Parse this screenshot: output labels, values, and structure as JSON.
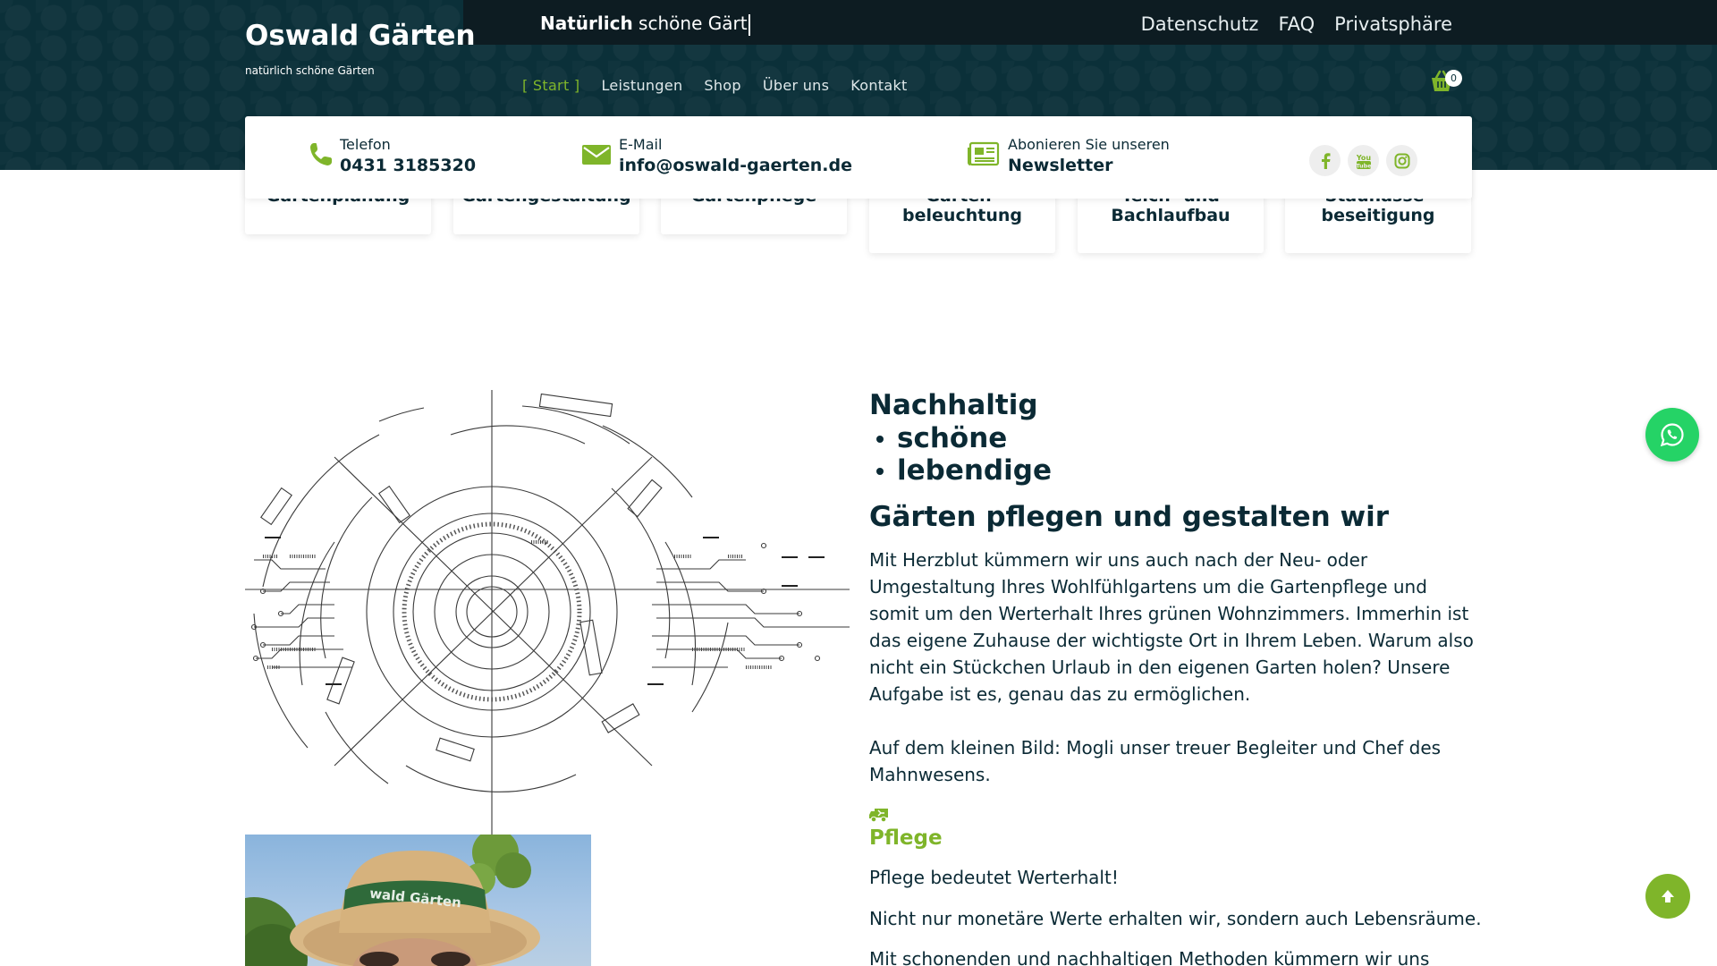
{
  "brand": {
    "title": "Oswald Gärten",
    "subtitle": "natürlich schöne Gärten"
  },
  "topbar": {
    "typing_bold": "Natürlich",
    "typing_rest": " schöne Gärt",
    "links": [
      "Datenschutz",
      "FAQ",
      "Privatsphäre"
    ]
  },
  "nav": {
    "items": [
      "[ Start ]",
      "Leistungen",
      "Shop",
      "Über uns",
      "Kontakt"
    ],
    "active_index": 0,
    "cart_count": "0",
    "cart_icon": "basket-icon"
  },
  "contact": {
    "phone": {
      "label": "Telefon",
      "value": "0431 3185320",
      "icon": "phone-icon"
    },
    "email": {
      "label": "E-Mail",
      "value": "info@oswald-gaerten.de",
      "icon": "envelope-icon"
    },
    "newsletter": {
      "label": "Abonieren Sie unseren",
      "value": "Newsletter",
      "icon": "newspaper-icon"
    },
    "social": [
      "facebook-icon",
      "youtube-icon",
      "instagram-icon"
    ]
  },
  "services": [
    "Gartenplanung",
    "Gartengestaltung",
    "Gartenpflege",
    "Garten-\nbeleuchtung",
    "Teich- und\nBachlaufbau",
    "Staunässe-\nbeseitigung"
  ],
  "content": {
    "heading_first": "Nachhaltig",
    "heading_list": [
      "schöne",
      "lebendige"
    ],
    "heading_2": "Gärten pflegen und gestalten wir",
    "paragraph_1": "Mit Herzblut kümmern wir uns auch nach der Neu- oder Umgestaltung Ihres Wohlfühlgartens um die Gartenpflege und somit um den Werterhalt Ihres grünen Wohnzimmers. Immerhin ist das eigene Zuhause der wichtigste Ort in Ihrem Leben. Warum also nicht ein Stückchen Urlaub in den eigenen Garten holen? Unsere Aufgabe ist es, genau das zu ermöglichen.",
    "paragraph_2": "Auf dem kleinen Bild: Mogli unser treuer Begleiter und Chef des Mahnwesens.",
    "pflege_title": "Pflege",
    "pflege_icon": "truck-icon",
    "pflege_1": "Pflege bedeutet Werterhalt!",
    "pflege_2": "Nicht nur monetäre Werte erhalten wir, sondern auch Lebensräume.",
    "pflege_3": "Mit schonenden und nachhaltigen Methoden kümmern wir uns",
    "photo_hat_text": "wald Gärten"
  },
  "colors": {
    "header_bg": "#0b3039",
    "topbar_bg": "#0d1c22",
    "accent_green": "#7fb52a",
    "text_dark": "#0b2a35",
    "whatsapp": "#25d366"
  }
}
